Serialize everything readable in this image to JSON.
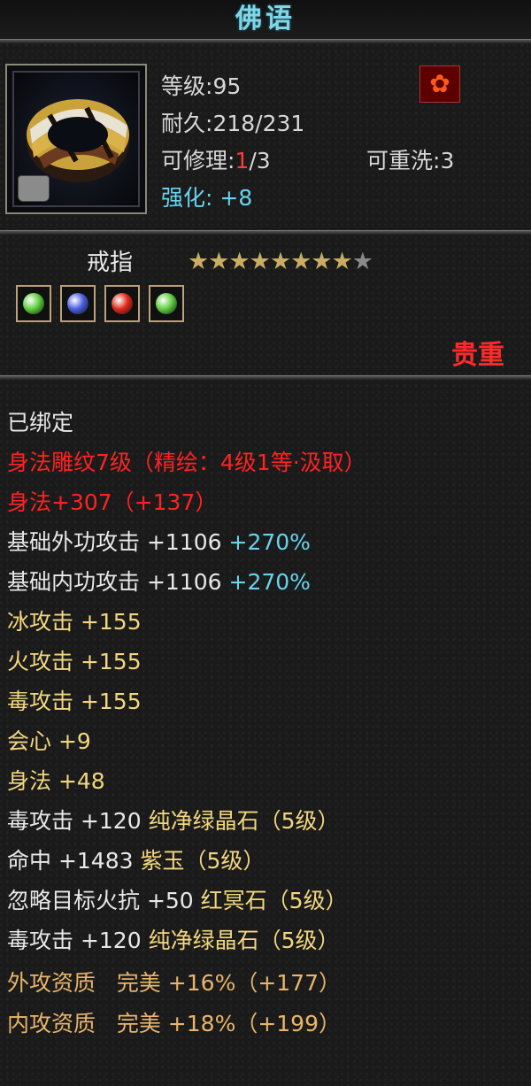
{
  "title": "佛语",
  "item": {
    "icon": "gold-ring-icon",
    "badge_icon": "bag-icon",
    "quality_icon": "flame-icon",
    "level_label": "等级",
    "level_value": "95",
    "durability_label": "耐久",
    "durability_value": "218/231",
    "repair_label": "可修理",
    "repair_current": "1",
    "repair_max": "/3",
    "rewash_label": "可重洗",
    "rewash_value": "3",
    "enhance_label": "强化:",
    "enhance_value": "+8",
    "type": "戒指",
    "stars_total": 9,
    "stars_filled": 8,
    "quality_text": "贵重"
  },
  "gems": [
    {
      "name": "green-gem-icon",
      "color": "#5fcf3f"
    },
    {
      "name": "blue-gem-icon",
      "color": "#4a5fe0"
    },
    {
      "name": "red-gem-icon",
      "color": "#e02a1a"
    },
    {
      "name": "green-gem-icon",
      "color": "#5fcf3f"
    }
  ],
  "stats": {
    "bound": "已绑定",
    "engrave": "身法雕纹7级（精绘：4级1等·汲取）",
    "agility_label": "身法",
    "agility_value": "+307（+137）",
    "ext_atk_label": "基础外功攻击",
    "ext_atk_value": "+1106",
    "ext_atk_pct": "+270%",
    "int_atk_label": "基础内功攻击",
    "int_atk_value": "+1106",
    "int_atk_pct": "+270%",
    "ice": "冰攻击 +155",
    "fire": "火攻击 +155",
    "poison": "毒攻击 +155",
    "crit": "会心 +9",
    "agility2": "身法 +48",
    "gem1_stat": "毒攻击 +120",
    "gem1_name": "纯净绿晶石（5级）",
    "gem2_stat": "命中 +1483",
    "gem2_name": "紫玉（5级）",
    "gem3_stat": "忽略目标火抗 +50",
    "gem3_name": "红冥石（5级）",
    "gem4_stat": "毒攻击 +120",
    "gem4_name": "纯净绿晶石（5级）",
    "ext_aptitude": "外攻资质",
    "ext_aptitude_value": "完美 +16%（+177）",
    "int_aptitude": "内攻资质",
    "int_aptitude_value": "完美 +18%（+199）"
  }
}
